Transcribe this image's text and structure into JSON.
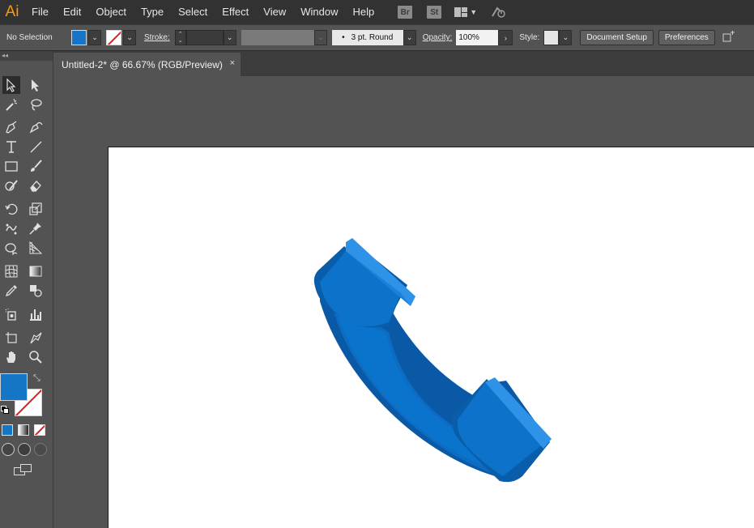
{
  "app": {
    "logo": "Ai"
  },
  "menu": [
    "File",
    "Edit",
    "Object",
    "Type",
    "Select",
    "Effect",
    "View",
    "Window",
    "Help"
  ],
  "menu_icons": {
    "bridge": "Br",
    "stock": "St",
    "workspace": "workspace-grid-icon",
    "sync": "sync-icon"
  },
  "control": {
    "selection": "No Selection",
    "stroke_label": "Stroke:",
    "brush": "3 pt. Round",
    "opacity_label": "Opacity:",
    "opacity_value": "100%",
    "style_label": "Style:",
    "document_setup": "Document Setup",
    "preferences": "Preferences"
  },
  "colors": {
    "fill": "#1576c8",
    "stroke": "none",
    "artwork_primary": "#0a73cc"
  },
  "tabs": {
    "title": "Untitled-2* @ 66.67% (RGB/Preview)",
    "close": "×"
  },
  "tools_header": "◂◂",
  "tools": [
    "selection-tool",
    "direct-selection-tool",
    "magic-wand-tool",
    "lasso-tool",
    "pen-tool",
    "curvature-tool",
    "type-tool",
    "line-segment-tool",
    "rectangle-tool",
    "paintbrush-tool",
    "shaper-tool",
    "eraser-tool",
    "rotate-tool",
    "scale-tool",
    "puppet-warp-tool",
    "pin-tool",
    "shape-builder-tool",
    "perspective-grid-tool",
    "mesh-tool",
    "gradient-tool",
    "eyedropper-tool",
    "blend-tool",
    "symbol-sprayer-tool",
    "column-graph-tool",
    "artboard-tool",
    "slice-tool",
    "hand-tool",
    "zoom-tool"
  ]
}
